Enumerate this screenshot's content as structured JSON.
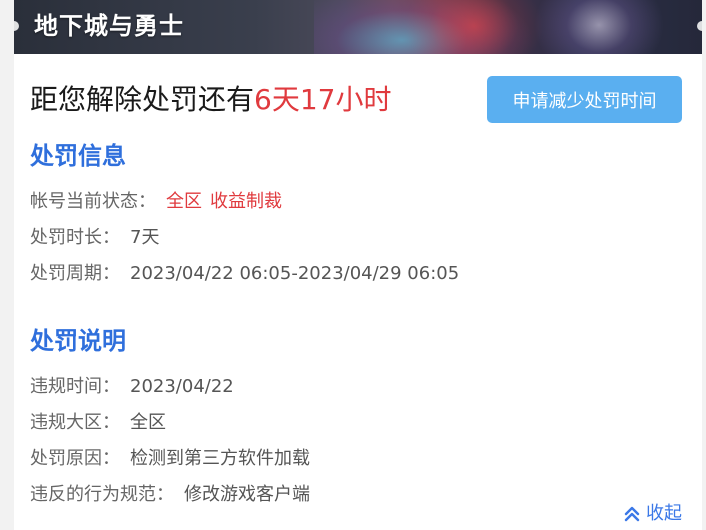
{
  "banner": {
    "title": "地下城与勇士"
  },
  "countdown": {
    "prefix": "距您解除处罚还有",
    "time": "6天17小时",
    "time_color": "#e03a3e"
  },
  "apply_button": {
    "label": "申请减少处罚时间",
    "color": "#5aaff0"
  },
  "penalty_info": {
    "title": "处罚信息",
    "rows": [
      {
        "label": "帐号当前状态：",
        "values": [
          "全区",
          "收益制裁"
        ],
        "highlight": true
      },
      {
        "label": "处罚时长：",
        "values": [
          "7天"
        ],
        "highlight": false
      },
      {
        "label": "处罚周期：",
        "values": [
          "2023/04/22 06:05-2023/04/29 06:05"
        ],
        "highlight": false
      }
    ]
  },
  "penalty_desc": {
    "title": "处罚说明",
    "rows": [
      {
        "label": "违规时间：",
        "value": "2023/04/22"
      },
      {
        "label": "违规大区：",
        "value": "全区"
      },
      {
        "label": "处罚原因：",
        "value": "检测到第三方软件加载"
      },
      {
        "label": "违反的行为规范：",
        "value": "修改游戏客户端"
      }
    ]
  },
  "collapse": {
    "label": "收起",
    "icon": "double-chevron-up-icon"
  },
  "colors": {
    "section_title": "#2f6fdc",
    "link": "#3b78e7"
  }
}
